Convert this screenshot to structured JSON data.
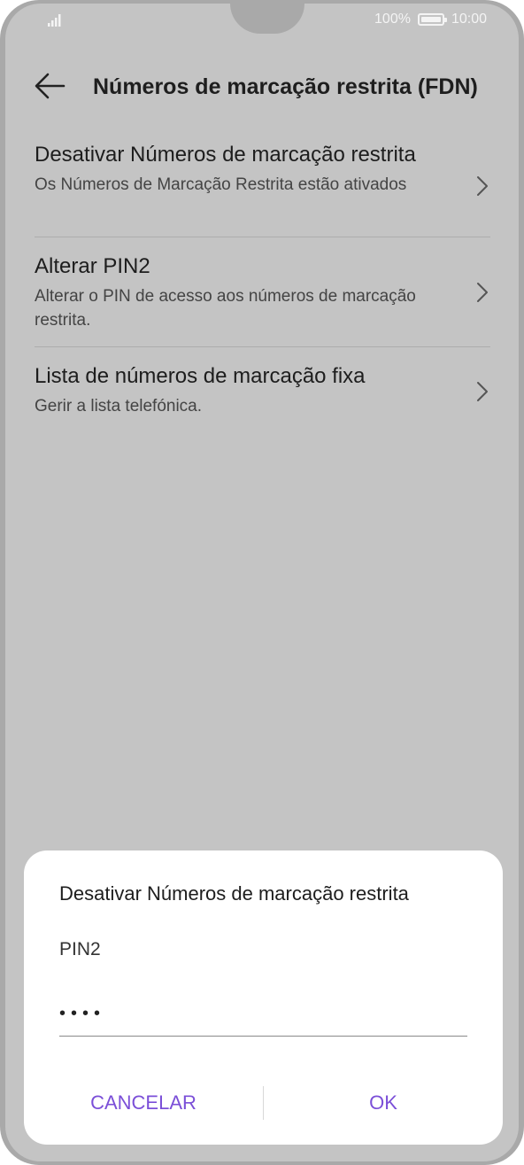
{
  "status_bar": {
    "battery": "100%",
    "time": "10:00"
  },
  "header": {
    "title": "Números de marcação restrita (FDN)"
  },
  "list": {
    "items": [
      {
        "title": "Desativar Números de marcação restrita",
        "subtitle": "Os Números de Marcação Restrita estão ativados"
      },
      {
        "title": "Alterar PIN2",
        "subtitle": "Alterar o PIN de acesso aos números de marcação restrita."
      },
      {
        "title": "Lista de números de marcação fixa",
        "subtitle": "Gerir a lista telefónica."
      }
    ]
  },
  "dialog": {
    "title": "Desativar Números de marcação restrita",
    "field_label": "PIN2",
    "field_value": "••••",
    "cancel_label": "CANCELAR",
    "ok_label": "OK"
  },
  "colors": {
    "accent": "#7b4fd8",
    "scrim_background": "#c4c4c4",
    "dialog_background": "#ffffff"
  },
  "icons": [
    "signal-icon",
    "battery-icon",
    "back-arrow-icon",
    "chevron-right-icon"
  ]
}
